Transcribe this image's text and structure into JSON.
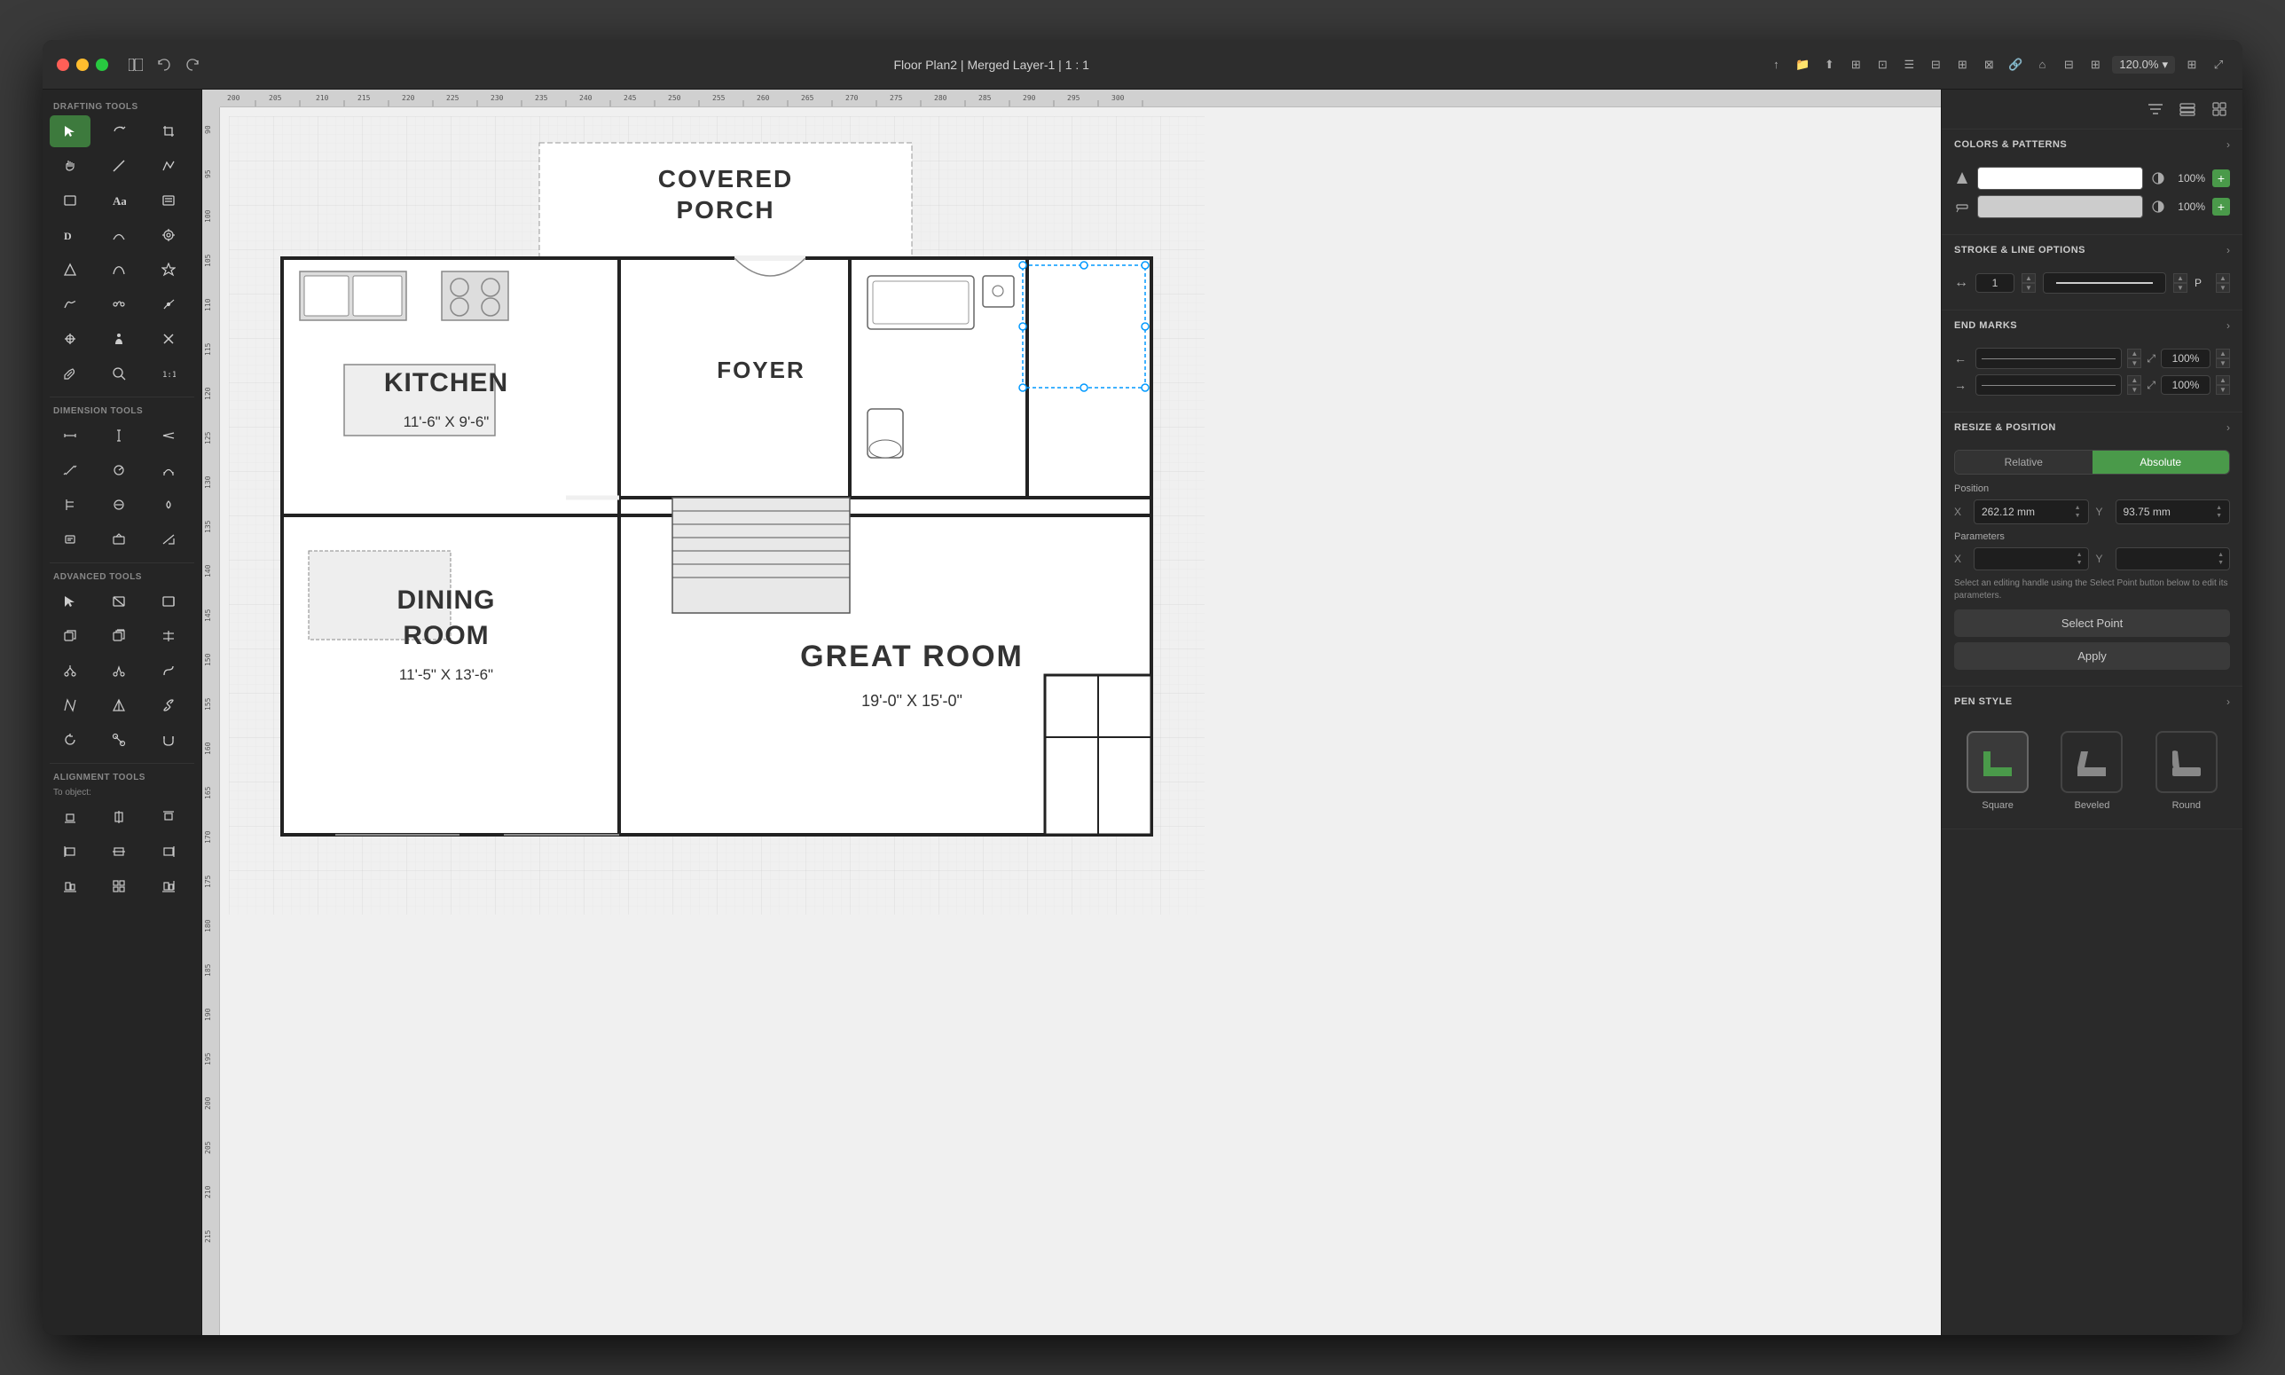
{
  "window": {
    "title": "Floor Plan2 | Merged Layer-1 | 1 : 1",
    "zoom": "120.0%"
  },
  "title_bar": {
    "back_icon": "◁",
    "forward_icon": "▷",
    "sidebar_icon": "⊞",
    "share_icon": "↑",
    "fullscreen_icon": "⤢"
  },
  "toolbar": {
    "drafting_tools_label": "Drafting Tools",
    "dimension_tools_label": "Dimension Tools",
    "advanced_tools_label": "Advanced Tools",
    "alignment_tools_label": "Alignment Tools",
    "to_object_label": "To object:"
  },
  "right_panel": {
    "colors_patterns": {
      "title": "COLORS & PATTERNS",
      "fill_opacity": "100%",
      "stroke_opacity": "100%"
    },
    "stroke_line": {
      "title": "STROKE & LINE OPTIONS",
      "stroke_value": "1",
      "stroke_unit": "P"
    },
    "end_marks": {
      "title": "END MARKS",
      "left_scale": "100%",
      "right_scale": "100%"
    },
    "resize_position": {
      "title": "RESIZE & POSITION",
      "relative_label": "Relative",
      "absolute_label": "Absolute",
      "position_label": "Position",
      "x_value": "262.12 mm",
      "y_value": "93.75 mm",
      "params_label": "Parameters",
      "param_x_label": "X",
      "param_y_label": "Y",
      "hint_text": "Select an editing handle using the Select Point button below to edit its parameters.",
      "select_point_label": "Select Point",
      "apply_label": "Apply"
    },
    "pen_style": {
      "title": "PEN STYLE",
      "square_label": "Square",
      "beveled_label": "Beveled",
      "round_label": "Round"
    }
  },
  "floor_plan": {
    "covered_porch": "COVERED\nPORCH",
    "foyer": "FOYER",
    "kitchen": "KITCHEN",
    "kitchen_dims": "11'-6\" X 9'-6\"",
    "dining_room": "DINING\nROOM",
    "dining_dims": "11'-5\" X 13'-6\"",
    "great_room": "GREAT ROOM",
    "great_room_dims": "19'-0\" X 15'-0\""
  },
  "icons": {
    "chevron_down": "›",
    "plus": "+",
    "add": "+",
    "layers": "⊟",
    "grid": "⊞",
    "filter": "≡"
  }
}
